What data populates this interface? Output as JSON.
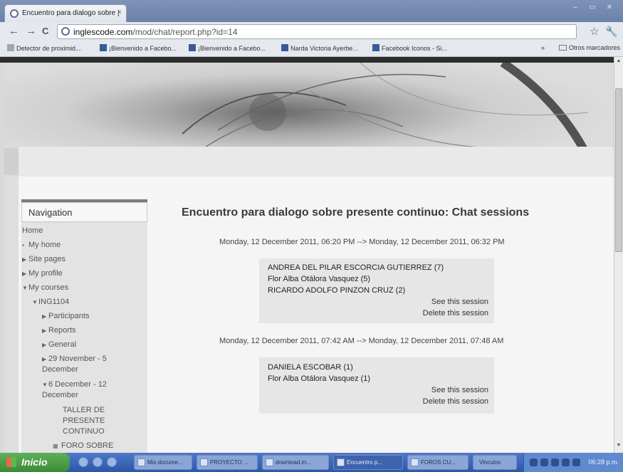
{
  "browser": {
    "tab_title": "Encuentro para dialogo sobre |",
    "tab_close": "×",
    "url_host": "inglescode.com",
    "url_path": "/mod/chat/report.php?id=14",
    "window_min": "–",
    "window_max": "▭",
    "window_close": "✕",
    "back": "←",
    "forward": "→",
    "reload": "C",
    "star": "☆",
    "wrench": "🔧"
  },
  "bookmarks": {
    "items": [
      "Detector de proximid...",
      "¡Bienvenido a Facebo...",
      "¡Bienvenido a Facebo...",
      "Narda Victoria Ayerbe...",
      "Facebook Iconos - Si..."
    ],
    "overflow": "»",
    "other": "Otros marcadores"
  },
  "nav": {
    "header": "Navigation",
    "home": "Home",
    "my_home": "My home",
    "site_pages": "Site pages",
    "my_profile": "My profile",
    "my_courses": "My courses",
    "course": "ING1104",
    "participants": "Participants",
    "reports": "Reports",
    "general": "General",
    "week1": "29 November - 5 December",
    "week2": "6 December - 12 December",
    "taller": "TALLER DE PRESENTE CONTINUO",
    "foro": "FORO SOBRE"
  },
  "main": {
    "title": "Encuentro para dialogo sobre presente continuo: Chat sessions",
    "sessions": [
      {
        "date": "Monday, 12 December 2011, 06:20 PM --> Monday, 12 December 2011, 06:32 PM",
        "participants": [
          "ANDREA DEL PILAR ESCORCIA GUTIERREZ (7)",
          "Flor Alba Otálora Vasquez (5)",
          "RICARDO ADOLFO PINZON CRUZ (2)"
        ],
        "see": "See this session",
        "delete": "Delete this session"
      },
      {
        "date": "Monday, 12 December 2011, 07:42 AM --> Monday, 12 December 2011, 07:48 AM",
        "participants": [
          "DANIELA ESCOBAR (1)",
          "Flor Alba Otálora Vasquez (1)"
        ],
        "see": "See this session",
        "delete": "Delete this session"
      }
    ]
  },
  "taskbar": {
    "start": "Inicio",
    "buttons": [
      "Mis docume...",
      "PROYECTO ...",
      "download.m...",
      "Encuentro p...",
      "FOROS CU...",
      "Vinculos"
    ],
    "clock": "06:28 p.m."
  }
}
